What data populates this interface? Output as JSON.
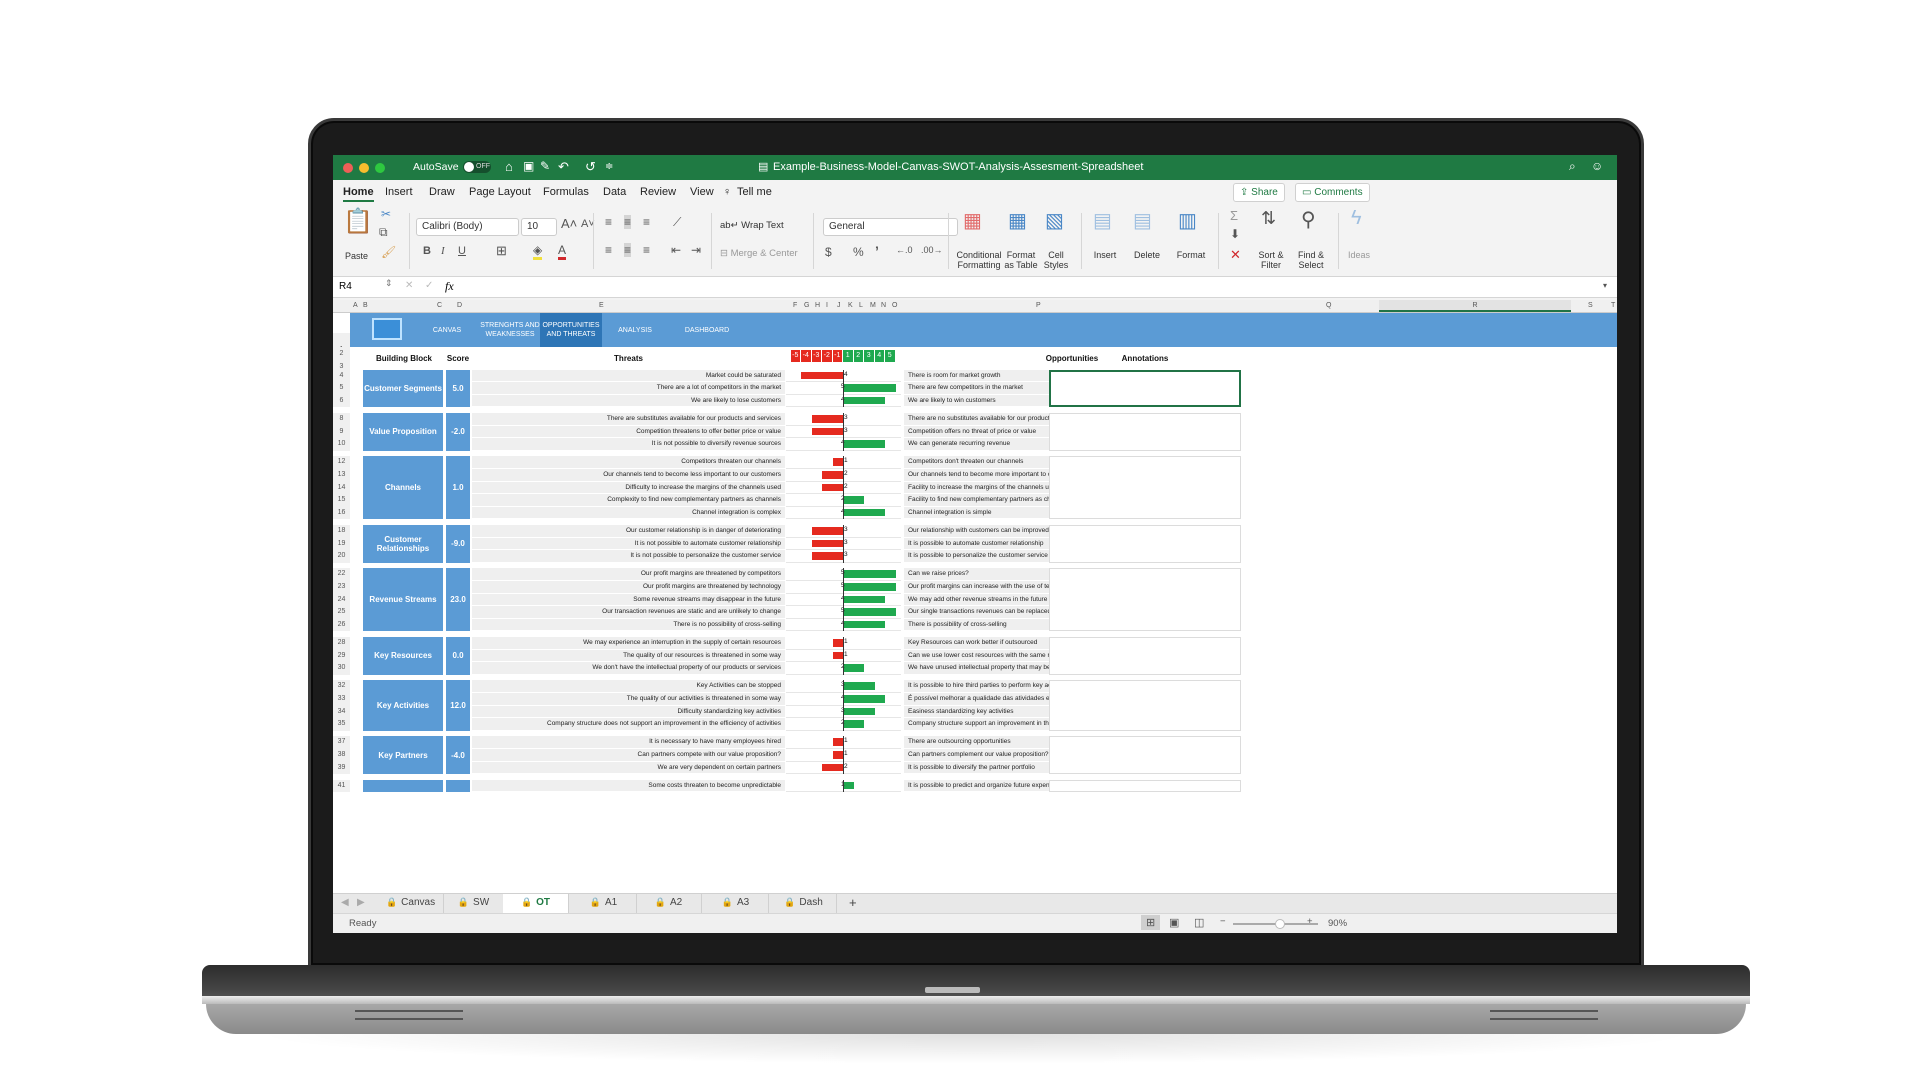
{
  "window": {
    "autosave_label": "AutoSave",
    "autosave_state": "OFF",
    "title": "Example-Business-Model-Canvas-SWOT-Analysis-Assesment-Spreadsheet"
  },
  "menu": {
    "tabs": [
      "Home",
      "Insert",
      "Draw",
      "Page Layout",
      "Formulas",
      "Data",
      "Review",
      "View"
    ],
    "active_tab": "Home",
    "tell_me": "Tell me",
    "share": "Share",
    "comments": "Comments"
  },
  "ribbon": {
    "paste": "Paste",
    "font_name": "Calibri (Body)",
    "font_size": "10",
    "bold": "B",
    "italic": "I",
    "underline": "U",
    "wrap_text": "Wrap Text",
    "merge_center": "Merge & Center",
    "number_format": "General",
    "currency": "$",
    "percent": "%",
    "comma": "’",
    "conditional_formatting": "Conditional Formatting",
    "format_as_table": "Format as Table",
    "cell_styles": "Cell Styles",
    "insert": "Insert",
    "delete": "Delete",
    "format": "Format",
    "sort_filter": "Sort & Filter",
    "find_select": "Find & Select",
    "ideas": "Ideas"
  },
  "formula_bar": {
    "name_box": "R4",
    "fx": "fx",
    "value": ""
  },
  "columns": [
    "A",
    "B",
    "C",
    "D",
    "E",
    "F",
    "G",
    "H",
    "I",
    "J",
    "K",
    "L",
    "M",
    "N",
    "O",
    "P",
    "Q",
    "R",
    "S",
    "T"
  ],
  "nav": {
    "links": [
      {
        "label": "CANVAS",
        "active": false
      },
      {
        "label": "STRENGHTS AND WEAKNESSES",
        "active": false
      },
      {
        "label": "OPPORTUNITIES AND THREATS",
        "active": true
      },
      {
        "label": "ANALYSIS",
        "active": false
      },
      {
        "label": "DASHBOARD",
        "active": false
      }
    ]
  },
  "headers": {
    "building_block": "Building Block",
    "score": "Score",
    "threats": "Threats",
    "opportunities": "Opportunities",
    "annotations": "Annotations",
    "scale": [
      "-5",
      "-4",
      "-3",
      "-2",
      "-1",
      "1",
      "2",
      "3",
      "4",
      "5"
    ]
  },
  "colors": {
    "threat_bar": "#e52a1f",
    "opportunity_bar": "#1fa94f",
    "block_fill": "#5b9bd5",
    "excel_green": "#1f7a43"
  },
  "blocks": [
    {
      "name": "Customer Segments",
      "score": "5.0",
      "rows": [
        {
          "row": 4,
          "threat": "Market could be saturated",
          "value": -4,
          "opportunity": "There is room for market growth"
        },
        {
          "row": 5,
          "threat": "There are a lot of competitors in the market",
          "value": 5,
          "opportunity": "There are few competitors in the market"
        },
        {
          "row": 6,
          "threat": "We are likely to lose customers",
          "value": 4,
          "opportunity": "We are likely to win customers"
        }
      ]
    },
    {
      "name": "Value Proposition",
      "score": "-2.0",
      "rows": [
        {
          "row": 8,
          "threat": "There are substitutes available for our products and services",
          "value": -3,
          "opportunity": "There are no substitutes available for our products and services"
        },
        {
          "row": 9,
          "threat": "Competition threatens to offer better price or value",
          "value": -3,
          "opportunity": "Competition offers no threat of price or value"
        },
        {
          "row": 10,
          "threat": "It is not possible to diversify revenue sources",
          "value": 4,
          "opportunity": "We can generate recurring revenue"
        }
      ]
    },
    {
      "name": "Channels",
      "score": "1.0",
      "rows": [
        {
          "row": 12,
          "threat": "Competitors threaten our channels",
          "value": -1,
          "opportunity": "Competitors don't threaten our channels"
        },
        {
          "row": 13,
          "threat": "Our channels tend to become less important to our customers",
          "value": -2,
          "opportunity": "Our channels tend to become more important to our customers"
        },
        {
          "row": 14,
          "threat": "Difficulty to increase the margins of the channels used",
          "value": -2,
          "opportunity": "Facility to increase the margins of the channels used"
        },
        {
          "row": 15,
          "threat": "Complexity to find new complementary partners as channels",
          "value": 2,
          "opportunity": "Facility to find new complementary partners as channels"
        },
        {
          "row": 16,
          "threat": "Channel integration is complex",
          "value": 4,
          "opportunity": "Channel integration is simple"
        }
      ]
    },
    {
      "name": "Customer Relationships",
      "score": "-9.0",
      "rows": [
        {
          "row": 18,
          "threat": "Our customer relationship is in danger of deteriorating",
          "value": -3,
          "opportunity": "Our relationship with customers can be improved"
        },
        {
          "row": 19,
          "threat": "It is not possible to automate customer relationship",
          "value": -3,
          "opportunity": "It is possible to automate customer relationship"
        },
        {
          "row": 20,
          "threat": "It is not possible to personalize the customer service",
          "value": -3,
          "opportunity": "It is possible to personalize the customer service"
        }
      ]
    },
    {
      "name": "Revenue Streams",
      "score": "23.0",
      "rows": [
        {
          "row": 22,
          "threat": "Our profit margins are threatened by competitors",
          "value": 5,
          "opportunity": "Can we raise prices?"
        },
        {
          "row": 23,
          "threat": "Our profit margins are threatened by technology",
          "value": 5,
          "opportunity": "Our profit margins can increase with the use of technology"
        },
        {
          "row": 24,
          "threat": "Some revenue streams may disappear in the future",
          "value": 4,
          "opportunity": "We may add other revenue streams in the future"
        },
        {
          "row": 25,
          "threat": "Our transaction revenues are static and are unlikely to change",
          "value": 5,
          "opportunity": "Our single transactions revenues can be replaced by recurring revenues"
        },
        {
          "row": 26,
          "threat": "There is no possibility of cross-selling",
          "value": 4,
          "opportunity": "There is possibility of cross-selling"
        }
      ]
    },
    {
      "name": "Key Resources",
      "score": "0.0",
      "rows": [
        {
          "row": 28,
          "threat": "We may experience an interruption in the supply of certain resources",
          "value": -1,
          "opportunity": "Key Resources can work better if outsourced"
        },
        {
          "row": 29,
          "threat": "The quality of our resources is threatened in some way",
          "value": -1,
          "opportunity": "Can we use lower cost resources with the same results?"
        },
        {
          "row": 30,
          "threat": "We don't have the intellectual property of our products or services",
          "value": 2,
          "opportunity": "We have unused intellectual property that may be of value to others"
        }
      ]
    },
    {
      "name": "Key Activities",
      "score": "12.0",
      "rows": [
        {
          "row": 32,
          "threat": "Key Activities can be stopped",
          "value": 3,
          "opportunity": "It is possible to hire third parties to perform key activities"
        },
        {
          "row": 33,
          "threat": "The quality of our activities is threatened in some way",
          "value": 4,
          "opportunity": "É possível melhorar a qualidade das atividades executadas"
        },
        {
          "row": 34,
          "threat": "Difficulty standardizing key activities",
          "value": 3,
          "opportunity": "Easiness standardizing key activities"
        },
        {
          "row": 35,
          "threat": "Company structure does not support an improvement in the efficiency of activities",
          "value": 2,
          "opportunity": "Company structure support an improvement in the efficiency of activities"
        }
      ]
    },
    {
      "name": "Key Partners",
      "score": "-4.0",
      "rows": [
        {
          "row": 37,
          "threat": "It is necessary to have many employees hired",
          "value": -1,
          "opportunity": "There are outsourcing opportunities"
        },
        {
          "row": 38,
          "threat": "Can partners compete with our value proposition?",
          "value": -1,
          "opportunity": "Can partners complement our value proposition?"
        },
        {
          "row": 39,
          "threat": "We are very dependent on certain partners",
          "value": -2,
          "opportunity": "It is possible to diversify the partner portfolio"
        }
      ]
    },
    {
      "name": "",
      "score": "",
      "rows": [
        {
          "row": 41,
          "threat": "Some costs threaten to become unpredictable",
          "value": 1,
          "opportunity": "It is possible to predict and organize future expenses"
        }
      ]
    }
  ],
  "sheet_tabs": [
    {
      "label": "Canvas",
      "locked": true,
      "active": false
    },
    {
      "label": "SW",
      "locked": true,
      "active": false
    },
    {
      "label": "OT",
      "locked": true,
      "active": true
    },
    {
      "label": "A1",
      "locked": true,
      "active": false
    },
    {
      "label": "A2",
      "locked": true,
      "active": false
    },
    {
      "label": "A3",
      "locked": true,
      "active": false
    },
    {
      "label": "Dash",
      "locked": true,
      "active": false
    }
  ],
  "status": {
    "ready": "Ready",
    "zoom": "90%",
    "zoom_fraction": 0.55
  }
}
